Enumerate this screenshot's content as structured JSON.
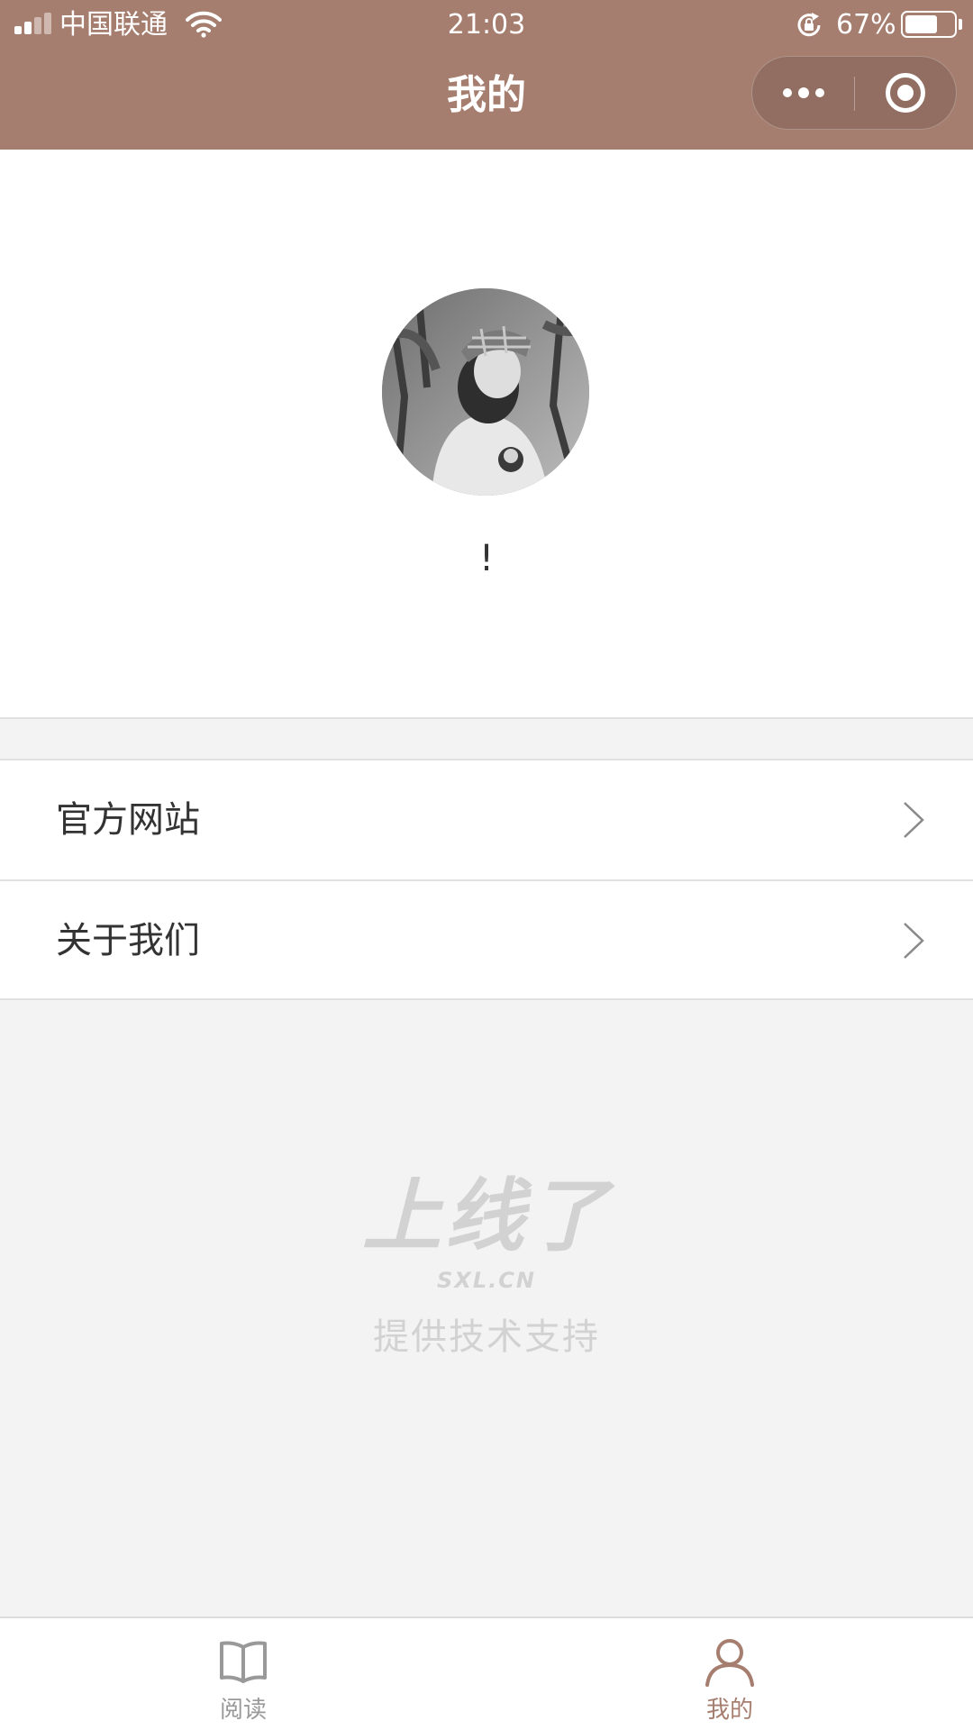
{
  "status_bar": {
    "carrier": "中国联通",
    "time": "21:03",
    "battery_percent": "67%",
    "battery_level": 0.67,
    "signal_bars_active": 2,
    "signal_bars_total": 4
  },
  "nav": {
    "title": "我的",
    "more_icon": "more-dots-icon",
    "close_icon": "mini-program-close-icon"
  },
  "profile": {
    "username": "!"
  },
  "menu": {
    "items": [
      {
        "label": "官方网站"
      },
      {
        "label": "关于我们"
      }
    ]
  },
  "powered_by": {
    "logo_text": "上线了",
    "domain": "SXL.CN",
    "text": "提供技术支持"
  },
  "tabbar": {
    "tabs": [
      {
        "label": "阅读",
        "icon": "book-icon",
        "active": false
      },
      {
        "label": "我的",
        "icon": "user-icon",
        "active": true
      }
    ]
  },
  "colors": {
    "accent": "#a67e6f",
    "background": "#f3f3f3",
    "inactive": "#999999",
    "text": "#333333"
  }
}
